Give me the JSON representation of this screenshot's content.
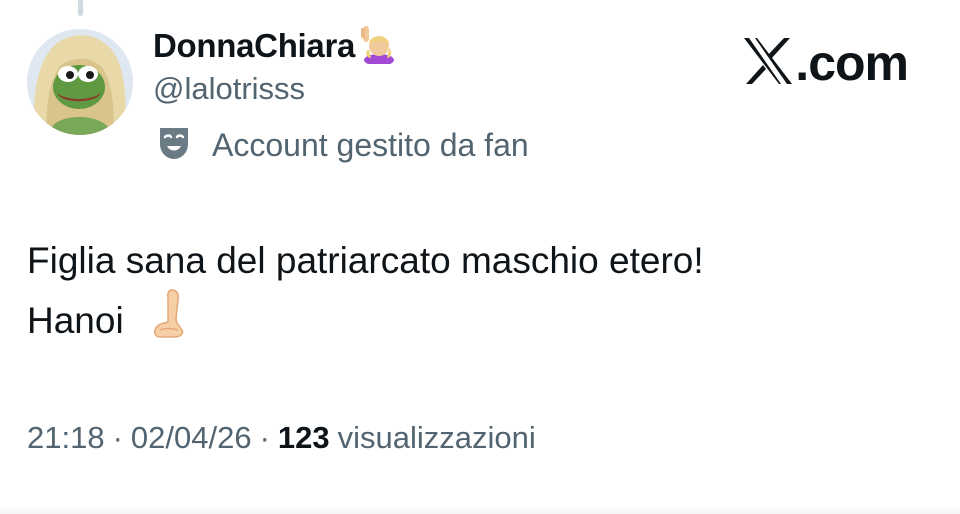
{
  "author": {
    "display_name": "DonnaChiara",
    "handle": "@lalotrisss",
    "badge_label": "Account gestito da fan",
    "avatar_icon": "pepe-frog-avatar",
    "name_emoji": "raising-hand-emoji"
  },
  "brand": {
    "logo_icon": "x-logo-icon",
    "text": ".com"
  },
  "tweet": {
    "line1": "Figlia sana del patriarcato maschio etero!",
    "line2": "Hanoi",
    "line2_emoji": "hand-emoji"
  },
  "meta": {
    "time": "21:18",
    "separator": "·",
    "date": "02/04/26",
    "views_count": "123",
    "views_label": "visualizzazioni"
  },
  "colors": {
    "text": "#0f1419",
    "secondary": "#536471",
    "background": "#ffffff"
  }
}
